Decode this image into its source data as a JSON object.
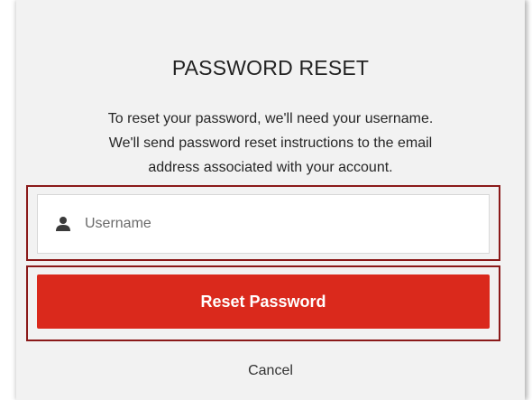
{
  "dialog": {
    "title": "PASSWORD RESET",
    "description_lines": [
      "To reset your password, we'll need your username.",
      "We'll send password reset instructions to the email",
      "address associated with your account."
    ],
    "username": {
      "icon": "user-icon",
      "placeholder": "Username",
      "value": ""
    },
    "reset_button_label": "Reset Password",
    "cancel_label": "Cancel"
  },
  "colors": {
    "accent": "#da291c",
    "highlight_border": "#8b1a1a",
    "panel_background": "#f2f2f2"
  }
}
